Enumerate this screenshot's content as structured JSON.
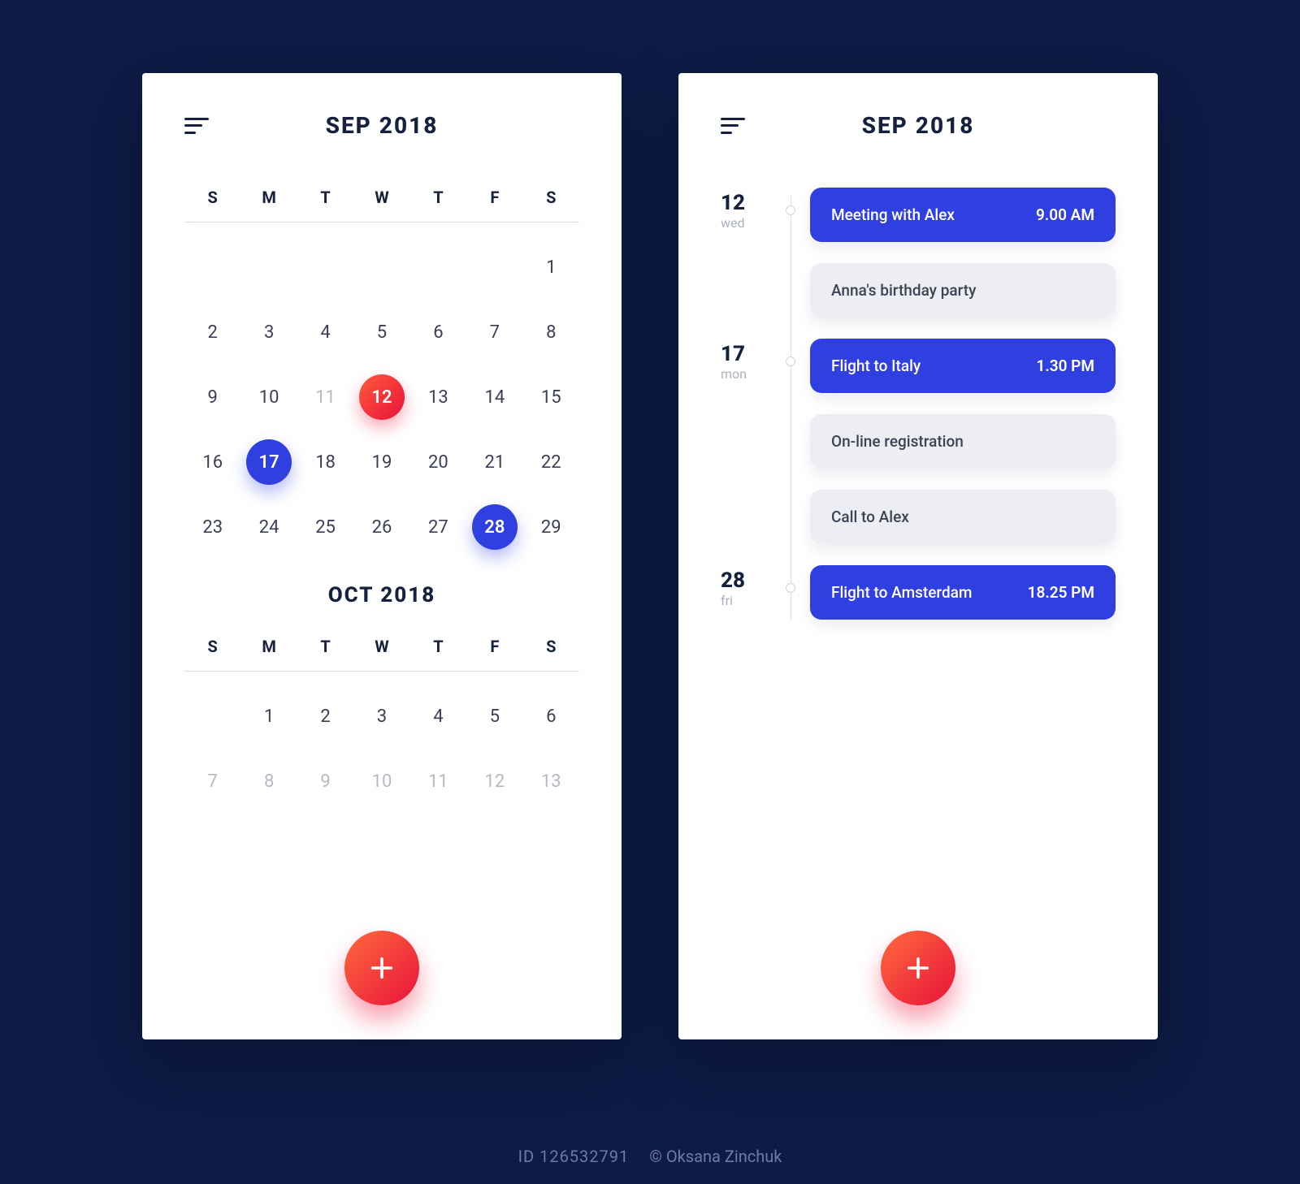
{
  "colors": {
    "accent_red": "#e8123a",
    "accent_blue": "#2f3fe0",
    "bg": "#0d1b45"
  },
  "left": {
    "header": "SEP 2018",
    "months": [
      {
        "title": "",
        "dow": [
          "S",
          "M",
          "T",
          "W",
          "T",
          "F",
          "S"
        ],
        "weeks": [
          [
            {
              "n": ""
            },
            {
              "n": ""
            },
            {
              "n": ""
            },
            {
              "n": ""
            },
            {
              "n": ""
            },
            {
              "n": ""
            },
            {
              "n": "1"
            }
          ],
          [
            {
              "n": "2"
            },
            {
              "n": "3"
            },
            {
              "n": "4"
            },
            {
              "n": "5"
            },
            {
              "n": "6"
            },
            {
              "n": "7"
            },
            {
              "n": "8"
            }
          ],
          [
            {
              "n": "9"
            },
            {
              "n": "10"
            },
            {
              "n": "11",
              "faded": true
            },
            {
              "n": "12",
              "mark": "red"
            },
            {
              "n": "13"
            },
            {
              "n": "14"
            },
            {
              "n": "15"
            }
          ],
          [
            {
              "n": "16"
            },
            {
              "n": "17",
              "mark": "blue"
            },
            {
              "n": "18"
            },
            {
              "n": "19"
            },
            {
              "n": "20"
            },
            {
              "n": "21"
            },
            {
              "n": "22"
            }
          ],
          [
            {
              "n": "23"
            },
            {
              "n": "24"
            },
            {
              "n": "25"
            },
            {
              "n": "26"
            },
            {
              "n": "27"
            },
            {
              "n": "28",
              "mark": "blue"
            },
            {
              "n": "29"
            }
          ]
        ]
      },
      {
        "title": "OCT 2018",
        "dow": [
          "S",
          "M",
          "T",
          "W",
          "T",
          "F",
          "S"
        ],
        "weeks": [
          [
            {
              "n": ""
            },
            {
              "n": "1"
            },
            {
              "n": "2"
            },
            {
              "n": "3"
            },
            {
              "n": "4"
            },
            {
              "n": "5"
            },
            {
              "n": "6"
            }
          ],
          [
            {
              "n": "7",
              "faded": true
            },
            {
              "n": "8",
              "faded": true
            },
            {
              "n": "9",
              "faded": true
            },
            {
              "n": "10",
              "faded": true
            },
            {
              "n": "11",
              "faded": true
            },
            {
              "n": "12",
              "faded": true
            },
            {
              "n": "13",
              "faded": true
            }
          ]
        ]
      }
    ]
  },
  "right": {
    "header": "SEP 2018",
    "items": [
      {
        "day": "12",
        "dow": "wed",
        "title": "Meeting with Alex",
        "time": "9.00 AM",
        "variant": "primary"
      },
      {
        "day": "",
        "dow": "",
        "title": "Anna's birthday party",
        "time": "",
        "variant": "secondary"
      },
      {
        "day": "17",
        "dow": "mon",
        "title": "Flight to Italy",
        "time": "1.30 PM",
        "variant": "primary"
      },
      {
        "day": "",
        "dow": "",
        "title": "On-line registration",
        "time": "",
        "variant": "secondary"
      },
      {
        "day": "",
        "dow": "",
        "title": "Call to Alex",
        "time": "",
        "variant": "secondary"
      },
      {
        "day": "28",
        "dow": "fri",
        "title": "Flight to Amsterdam",
        "time": "18.25 PM",
        "variant": "primary"
      }
    ]
  },
  "watermark": {
    "id": "ID 126532791",
    "author": "© Oksana Zinchuk"
  }
}
